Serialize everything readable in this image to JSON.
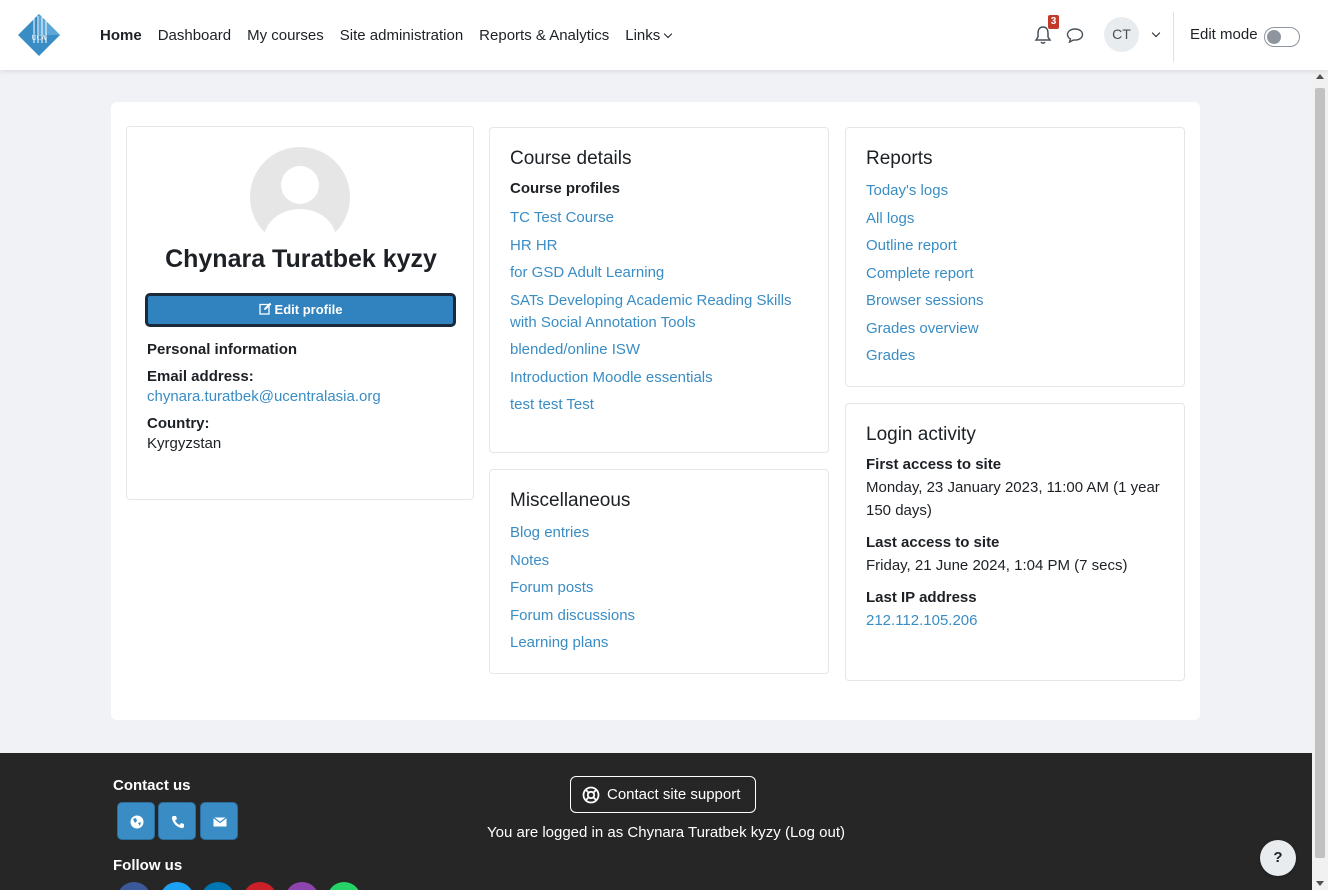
{
  "nav": {
    "logo_text": "UCA",
    "items": [
      {
        "label": "Home"
      },
      {
        "label": "Dashboard"
      },
      {
        "label": "My courses"
      },
      {
        "label": "Site administration"
      },
      {
        "label": "Reports & Analytics"
      },
      {
        "label": "Links"
      }
    ],
    "notification_count": "3",
    "avatar_initials": "CT",
    "edit_mode_label": "Edit mode"
  },
  "profile": {
    "name": "Chynara Turatbek kyzy",
    "edit_button": "Edit profile",
    "personal_info_heading": "Personal information",
    "email_label": "Email address:",
    "email_value": "chynara.turatbek@ucentralasia.org",
    "country_label": "Country:",
    "country_value": "Kyrgyzstan"
  },
  "course_details": {
    "title": "Course details",
    "subheading": "Course profiles",
    "links": [
      "TC Test Course",
      "HR HR",
      "for GSD Adult Learning",
      "SATs Developing Academic Reading Skills with Social Annotation Tools",
      "blended/online ISW",
      "Introduction Moodle essentials",
      "test test Test"
    ]
  },
  "misc": {
    "title": "Miscellaneous",
    "links": [
      "Blog entries",
      "Notes",
      "Forum posts",
      "Forum discussions",
      "Learning plans"
    ]
  },
  "reports": {
    "title": "Reports",
    "links": [
      "Today's logs",
      "All logs",
      "Outline report",
      "Complete report",
      "Browser sessions",
      "Grades overview",
      "Grades"
    ]
  },
  "login_activity": {
    "title": "Login activity",
    "first_access_label": "First access to site",
    "first_access_value": "Monday, 23 January 2023, 11:00 AM  (1 year 150 days)",
    "last_access_label": "Last access to site",
    "last_access_value": "Friday, 21 June 2024, 1:04 PM  (7 secs)",
    "last_ip_label": "Last IP address",
    "last_ip_value": "212.112.105.206"
  },
  "footer": {
    "contact_us": "Contact us",
    "follow_us": "Follow us",
    "support_button": "Contact site support",
    "logged_in_text": "You are logged in as Chynara Turatbek kyzy (Log out)",
    "help": "?"
  },
  "colors": {
    "link": "#3a8dc4",
    "primary_button": "#3083bf",
    "footer_bg": "#262626",
    "badge": "#c0392b"
  }
}
